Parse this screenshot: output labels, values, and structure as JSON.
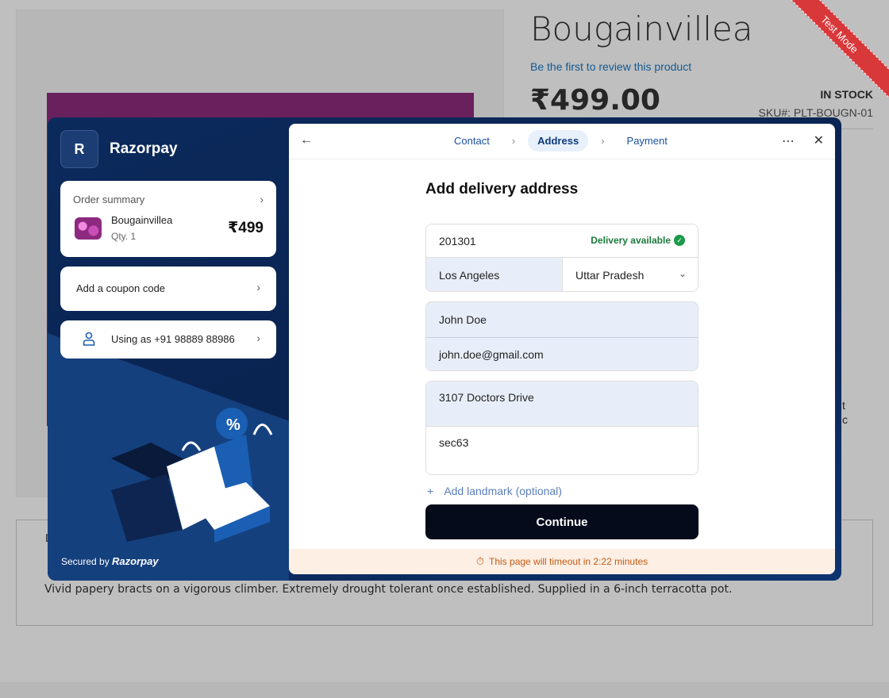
{
  "product": {
    "title": "Bougainvillea",
    "review_link": "Be the first to review this product",
    "price": "₹499.00",
    "stock": "IN STOCK",
    "sku": "SKU#:  PLT-BOUGN-01",
    "side_text_1": "t",
    "side_text_2": "c",
    "desc_tab": "D",
    "description": "Vivid papery bracts on a vigorous climber. Extremely drought tolerant once established. Supplied in a 6-inch terracotta pot."
  },
  "ribbon": "Test Mode",
  "razorpay": {
    "logo_letter": "R",
    "brand_name": "Razorpay",
    "order": {
      "label": "Order summary",
      "item_name": "Bougainvillea",
      "item_qty": "Qty. 1",
      "item_price": "₹499"
    },
    "coupon_label": "Add a coupon code",
    "user_label": "Using as +91 98889 88986",
    "secured_by": "Secured by",
    "secured_brand": "Razorpay"
  },
  "checkout": {
    "steps": [
      "Contact",
      "Address",
      "Payment"
    ],
    "active_step": "Address",
    "form_title": "Add delivery address",
    "pincode": "201301",
    "delivery_status": "Delivery available",
    "city": "Los Angeles",
    "state": "Uttar Pradesh",
    "name": "John Doe",
    "email": "john.doe@gmail.com",
    "address_line1": "3107 Doctors Drive",
    "address_line2": "sec63",
    "landmark": "Add landmark (optional)",
    "continue_label": "Continue",
    "timeout_text": "This page will timeout in 2:22 minutes"
  }
}
